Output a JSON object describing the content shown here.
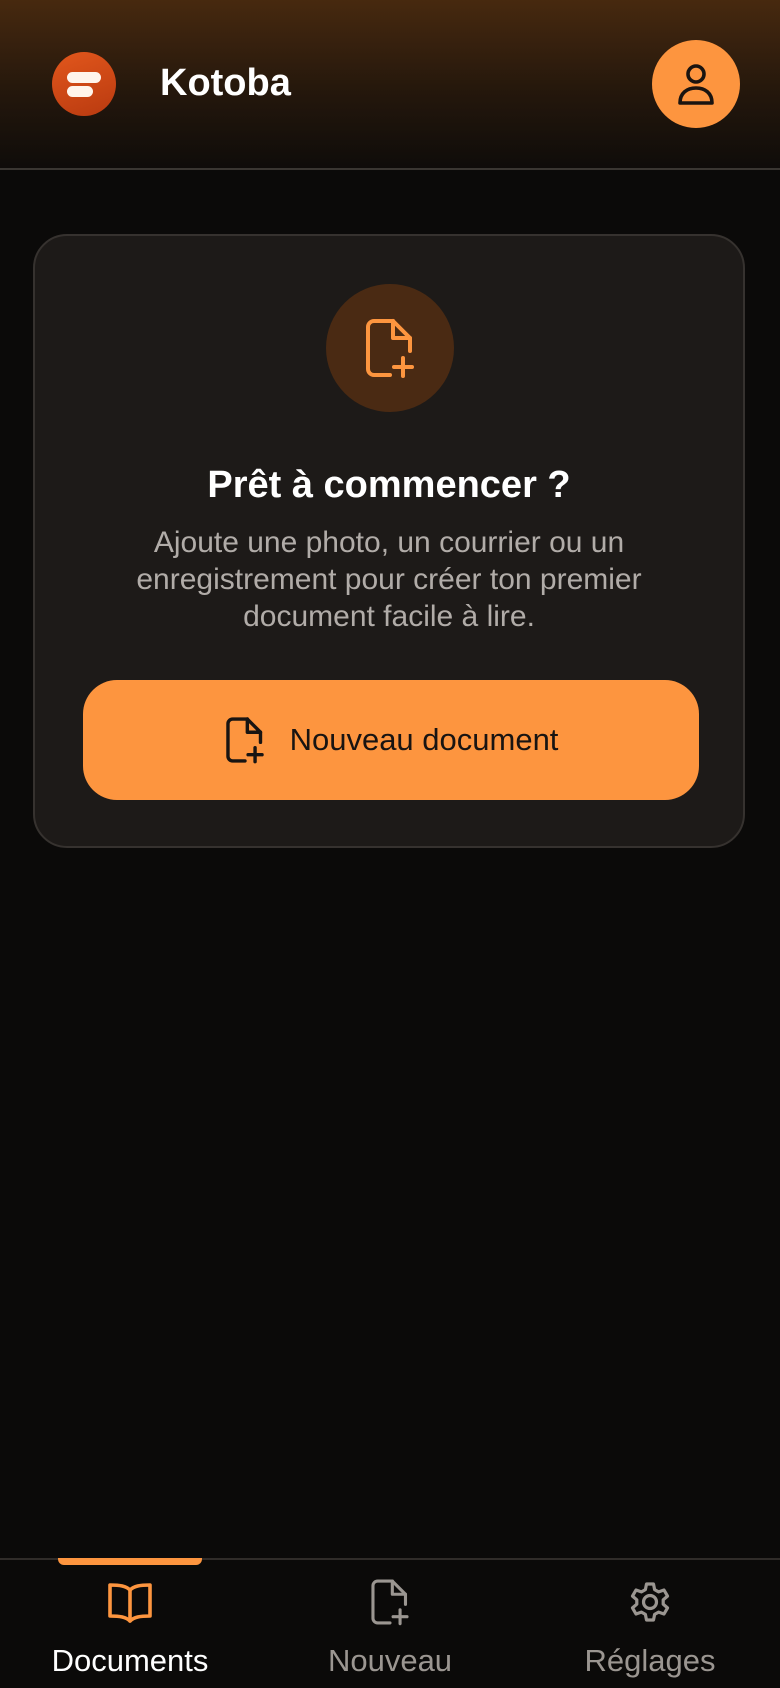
{
  "header": {
    "app_title": "Kotoba",
    "logo_icon": "kotoba-logo-icon",
    "profile_icon": "user-icon"
  },
  "empty_state": {
    "icon": "file-plus-icon",
    "title": "Prêt à commencer ?",
    "description": "Ajoute une photo, un courrier ou un enregistrement pour créer ton premier document facile à lire.",
    "button_label": "Nouveau document"
  },
  "bottom_nav": {
    "items": [
      {
        "label": "Documents",
        "icon": "book-open-icon",
        "active": true
      },
      {
        "label": "Nouveau",
        "icon": "file-plus-icon",
        "active": false
      },
      {
        "label": "Réglages",
        "icon": "gear-icon",
        "active": false
      }
    ]
  },
  "colors": {
    "accent": "#fd953f",
    "logo": "#d4491a",
    "background": "#0b0a09",
    "card": "#1d1a18",
    "inactive": "#9b9691"
  }
}
